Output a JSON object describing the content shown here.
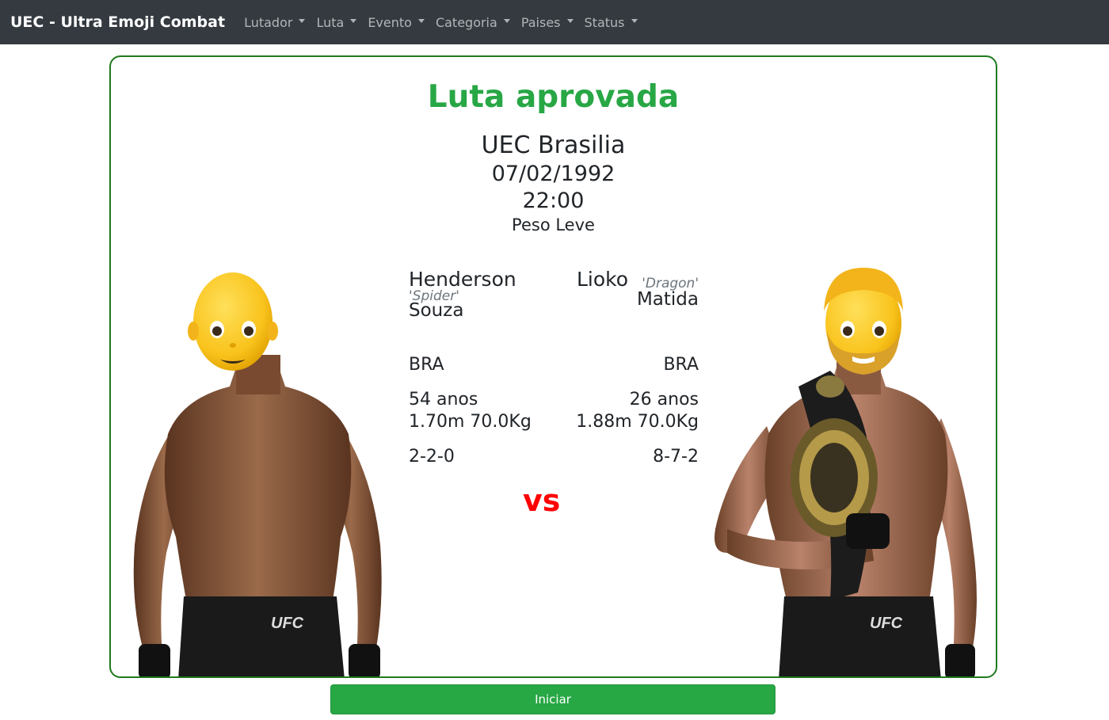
{
  "navbar": {
    "brand": "UEC - Ultra Emoji Combat",
    "menus": [
      {
        "label": "Lutador"
      },
      {
        "label": "Luta"
      },
      {
        "label": "Evento"
      },
      {
        "label": "Categoria"
      },
      {
        "label": "Paises"
      },
      {
        "label": "Status"
      }
    ]
  },
  "fight": {
    "status": "Luta aprovada",
    "event": "UEC Brasilia",
    "date": "07/02/1992",
    "time": "22:00",
    "category": "Peso Leve",
    "vs": "vs"
  },
  "fighters": [
    {
      "first_name": "Henderson",
      "nickname": "'Spider'",
      "last_name": "Souza",
      "country": "BRA",
      "age": "54 anos",
      "height_weight": "1.70m 70.0Kg",
      "record": "2-2-0",
      "emoji": "bald-face-emoji",
      "shorts_brand": "UFC"
    },
    {
      "first_name": "Lioko",
      "nickname": "'Dragon'",
      "last_name": "Matida",
      "country": "BRA",
      "age": "26 anos",
      "height_weight": "1.88m 70.0Kg",
      "record": "8-7-2",
      "emoji": "bearded-face-emoji",
      "shorts_brand": "UFC"
    }
  ],
  "actions": {
    "start_label": "Iniciar"
  },
  "colors": {
    "navbar_bg": "#343a40",
    "success": "#28a745",
    "card_border": "#1f7a1f",
    "vs_red": "#ff0000"
  }
}
